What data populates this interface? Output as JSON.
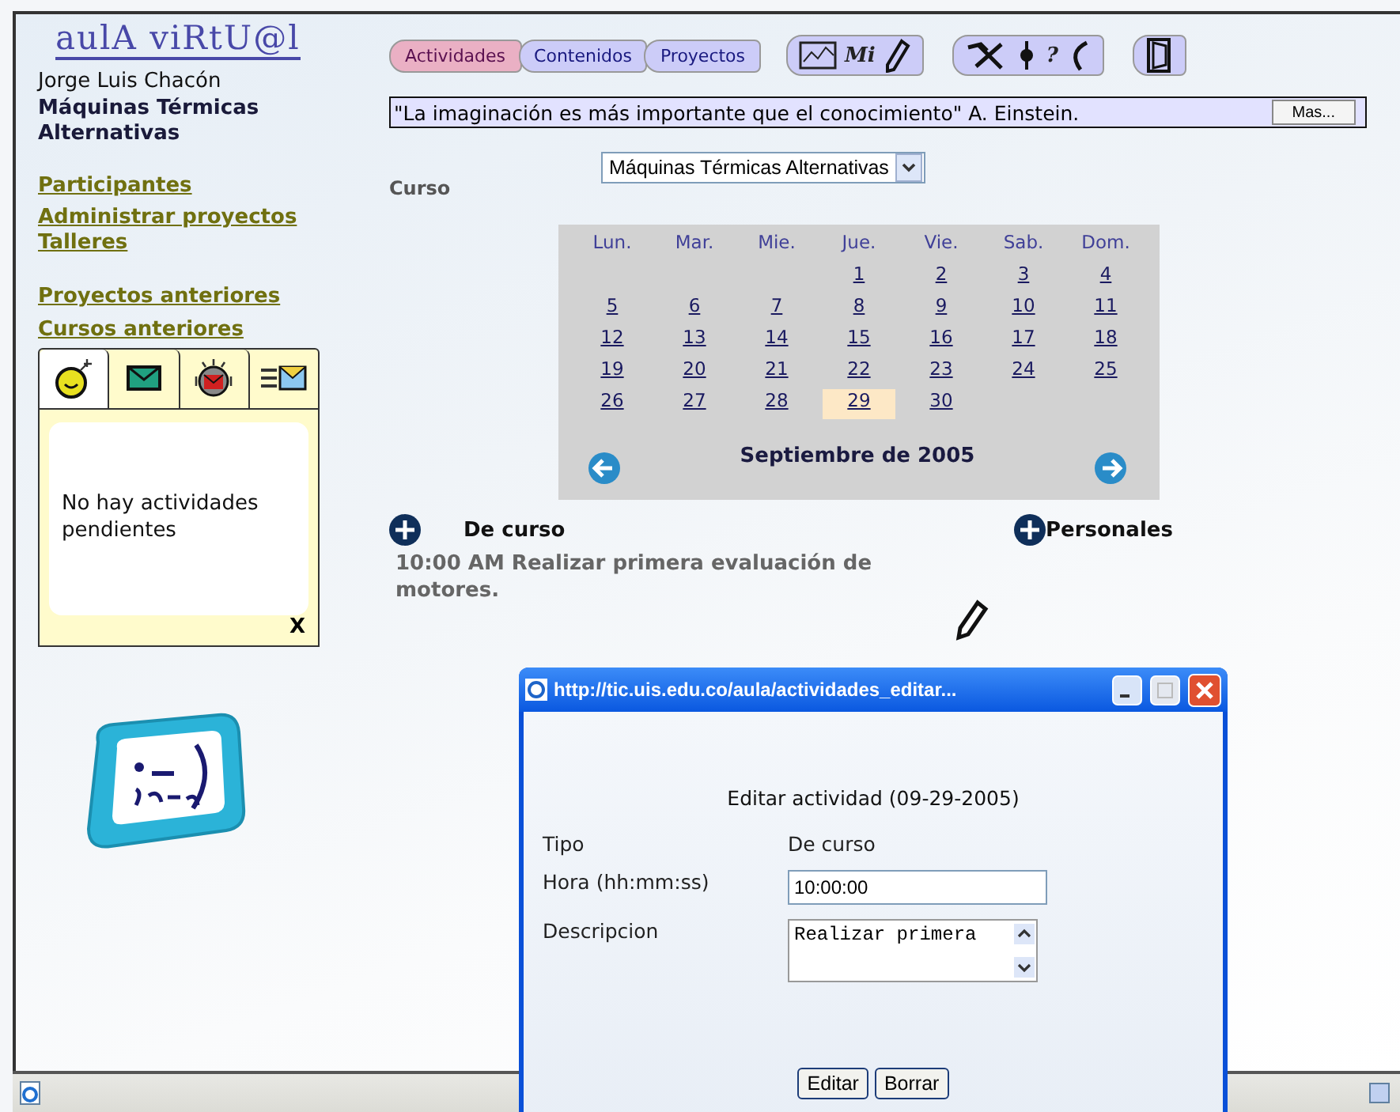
{
  "logo": {
    "title": "aulA viRtU@l"
  },
  "user": "Jorge Luis Chacón",
  "course_name": "Máquinas Térmicas Alternativas",
  "nav_links": [
    {
      "label": "Participantes"
    },
    {
      "label": "Administrar proyectos"
    },
    {
      "label": "Talleres"
    }
  ],
  "history_links": [
    {
      "label": "Proyectos anteriores"
    },
    {
      "label": "Cursos anteriores"
    }
  ],
  "panel": {
    "tabs": [
      {
        "kind": "bomb",
        "selected": true
      },
      {
        "kind": "mail",
        "selected": false
      },
      {
        "kind": "alert",
        "selected": false
      },
      {
        "kind": "sent",
        "selected": false
      }
    ],
    "message": "No hay actividades pendientes",
    "close": "X"
  },
  "top_tabs": [
    {
      "label": "Actividades",
      "selected": true
    },
    {
      "label": "Contenidos",
      "selected": false
    },
    {
      "label": "Proyectos",
      "selected": false
    }
  ],
  "tool_groups": [
    [
      {
        "kind": "chart"
      },
      {
        "kind": "text",
        "label": "Mi"
      },
      {
        "kind": "pencil"
      }
    ],
    [
      {
        "kind": "tools"
      },
      {
        "kind": "pin"
      },
      {
        "kind": "text",
        "label": "?"
      },
      {
        "kind": "phone"
      }
    ],
    [
      {
        "kind": "door"
      }
    ]
  ],
  "quote": {
    "text": "\"La imaginación es más importante que el conocimiento\" A. Einstein.",
    "button": "Mas..."
  },
  "course": {
    "label": "Curso",
    "value": "Máquinas Térmicas Alternativas"
  },
  "calendar": {
    "weekdays": [
      "Lun.",
      "Mar.",
      "Mie.",
      "Jue.",
      "Vie.",
      "Sab.",
      "Dom."
    ],
    "weeks": [
      [
        {
          "day": "1",
          "selected": false
        },
        {
          "day": "2",
          "selected": false
        },
        {
          "day": "3",
          "selected": false
        },
        {
          "day": "4",
          "selected": false
        }
      ],
      [
        {
          "day": "5",
          "selected": false
        },
        {
          "day": "6",
          "selected": false
        },
        {
          "day": "7",
          "selected": false
        },
        {
          "day": "8",
          "selected": false
        },
        {
          "day": "9",
          "selected": false
        },
        {
          "day": "10",
          "selected": false
        },
        {
          "day": "11",
          "selected": false
        }
      ],
      [
        {
          "day": "12",
          "selected": false
        },
        {
          "day": "13",
          "selected": false
        },
        {
          "day": "14",
          "selected": false
        },
        {
          "day": "15",
          "selected": false
        },
        {
          "day": "16",
          "selected": false
        },
        {
          "day": "17",
          "selected": false
        },
        {
          "day": "18",
          "selected": false
        }
      ],
      [
        {
          "day": "19",
          "selected": false
        },
        {
          "day": "20",
          "selected": false
        },
        {
          "day": "21",
          "selected": false
        },
        {
          "day": "22",
          "selected": false
        },
        {
          "day": "23",
          "selected": false
        },
        {
          "day": "24",
          "selected": false
        },
        {
          "day": "25",
          "selected": false
        }
      ],
      [
        {
          "day": "26",
          "selected": false
        },
        {
          "day": "27",
          "selected": false
        },
        {
          "day": "28",
          "selected": false
        },
        {
          "day": "29",
          "selected": true
        },
        {
          "day": "30",
          "selected": false
        }
      ]
    ],
    "month": "Septiembre de 2005"
  },
  "sections": [
    {
      "label": "De curso"
    },
    {
      "label": "Personales"
    }
  ],
  "activity": "10:00 AM Realizar primera evaluación de motores.",
  "dialog": {
    "title": "http://tic.uis.edu.co/aula/actividades_editar...",
    "heading": "Editar actividad (09-29-2005)",
    "fields": [
      {
        "kind": "text",
        "label": "Tipo",
        "value": "De curso"
      },
      {
        "kind": "input",
        "label": "Hora (hh:mm:ss)",
        "value": "10:00:00"
      },
      {
        "kind": "textarea",
        "label": "Descripcion",
        "value": "Realizar primera"
      }
    ],
    "buttons": [
      "Editar",
      "Borrar"
    ]
  }
}
